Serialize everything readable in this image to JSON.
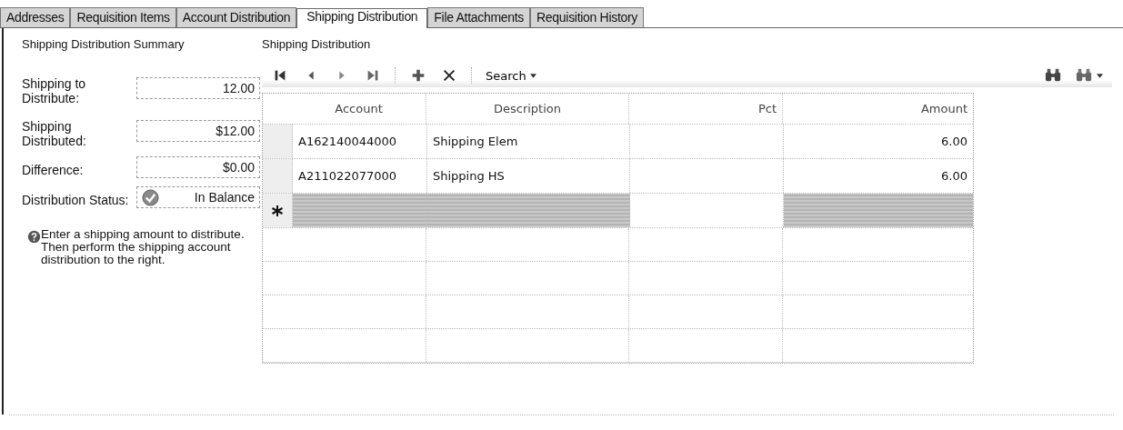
{
  "tabs": [
    {
      "label": "Addresses",
      "selected": false
    },
    {
      "label": "Requisition Items",
      "selected": false
    },
    {
      "label": "Account Distribution",
      "selected": false
    },
    {
      "label": "Shipping Distribution",
      "selected": true
    },
    {
      "label": "File Attachments",
      "selected": false
    },
    {
      "label": "Requisition History",
      "selected": false
    }
  ],
  "summary": {
    "title": "Shipping Distribution Summary",
    "fields": [
      {
        "label": "Shipping to Distribute:",
        "value": "12.00",
        "kind": "text"
      },
      {
        "label": "Shipping Distributed:",
        "value": "$12.00",
        "kind": "text"
      },
      {
        "label": "Difference:",
        "value": "$0.00",
        "kind": "text"
      },
      {
        "label": "Distribution Status:",
        "value": "In Balance",
        "kind": "status"
      }
    ],
    "help": "Enter a shipping amount to distribute. Then perform the shipping account distribution to the right."
  },
  "distribution": {
    "title": "Shipping Distribution",
    "toolbar": {
      "search": "Search"
    },
    "columns": [
      "Account",
      "Description",
      "Pct",
      "Amount"
    ],
    "rows": [
      {
        "kind": "data",
        "cells": [
          "A162140044000",
          "Shipping Elem",
          "",
          "6.00"
        ]
      },
      {
        "kind": "data",
        "cells": [
          "A211022077000",
          "Shipping HS",
          "",
          "6.00"
        ]
      },
      {
        "kind": "new",
        "cells": [
          "",
          "",
          "",
          ""
        ]
      }
    ]
  }
}
